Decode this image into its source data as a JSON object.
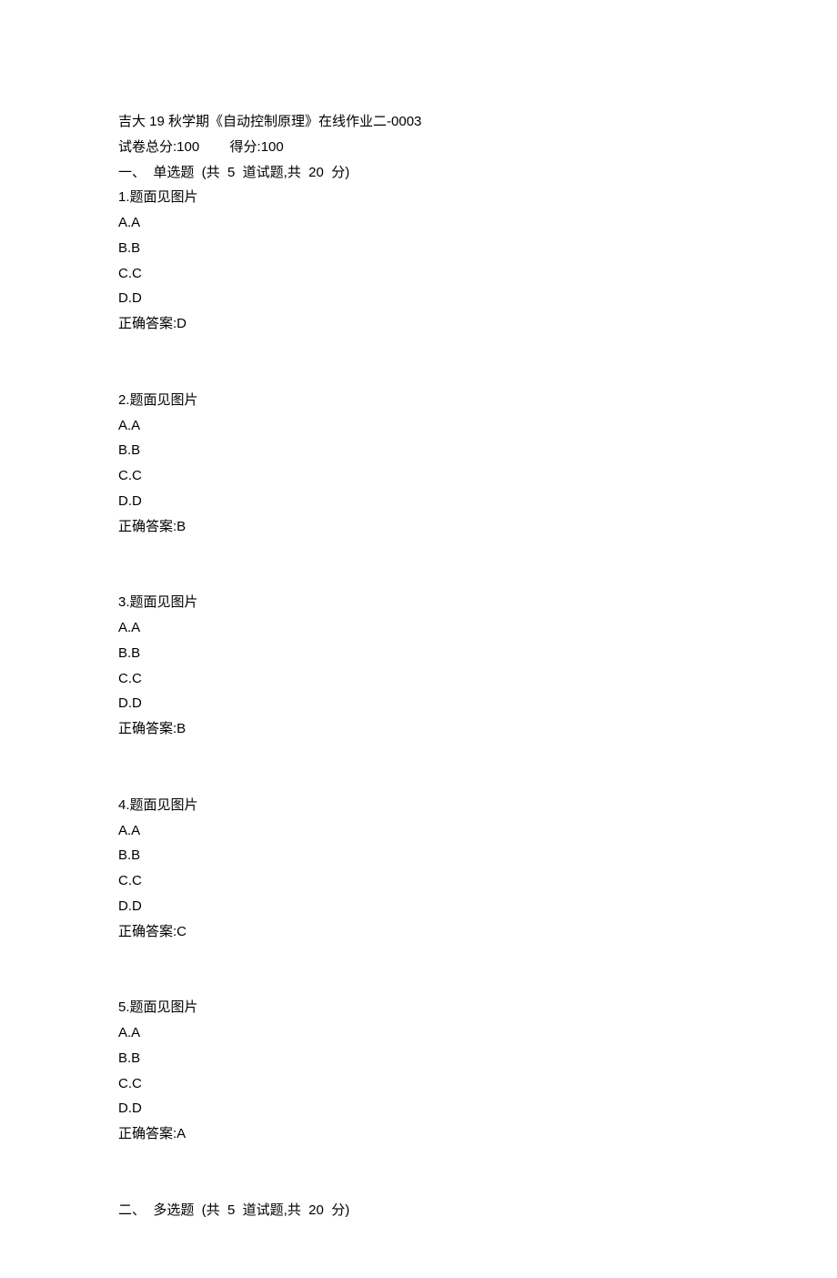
{
  "header": {
    "title": "吉大 19 秋学期《自动控制原理》在线作业二-0003",
    "score_label": "试卷总分:",
    "score_total": "100",
    "score_gap": "        ",
    "result_label": "得分:",
    "result_value": "100"
  },
  "section1": {
    "heading": "一、  单选题  (共  5  道试题,共  20  分)",
    "questions": [
      {
        "num": "1",
        "stem": ".题面见图片",
        "opts": [
          "A.A",
          "B.B",
          "C.C",
          "D.D"
        ],
        "ans_label": "正确答案:",
        "ans": "D"
      },
      {
        "num": "2",
        "stem": ".题面见图片",
        "opts": [
          "A.A",
          "B.B",
          "C.C",
          "D.D"
        ],
        "ans_label": "正确答案:",
        "ans": "B"
      },
      {
        "num": "3",
        "stem": ".题面见图片",
        "opts": [
          "A.A",
          "B.B",
          "C.C",
          "D.D"
        ],
        "ans_label": "正确答案:",
        "ans": "B"
      },
      {
        "num": "4",
        "stem": ".题面见图片",
        "opts": [
          "A.A",
          "B.B",
          "C.C",
          "D.D"
        ],
        "ans_label": "正确答案:",
        "ans": "C"
      },
      {
        "num": "5",
        "stem": ".题面见图片",
        "opts": [
          "A.A",
          "B.B",
          "C.C",
          "D.D"
        ],
        "ans_label": "正确答案:",
        "ans": "A"
      }
    ]
  },
  "section2": {
    "heading": "二、  多选题  (共  5  道试题,共  20  分)"
  }
}
